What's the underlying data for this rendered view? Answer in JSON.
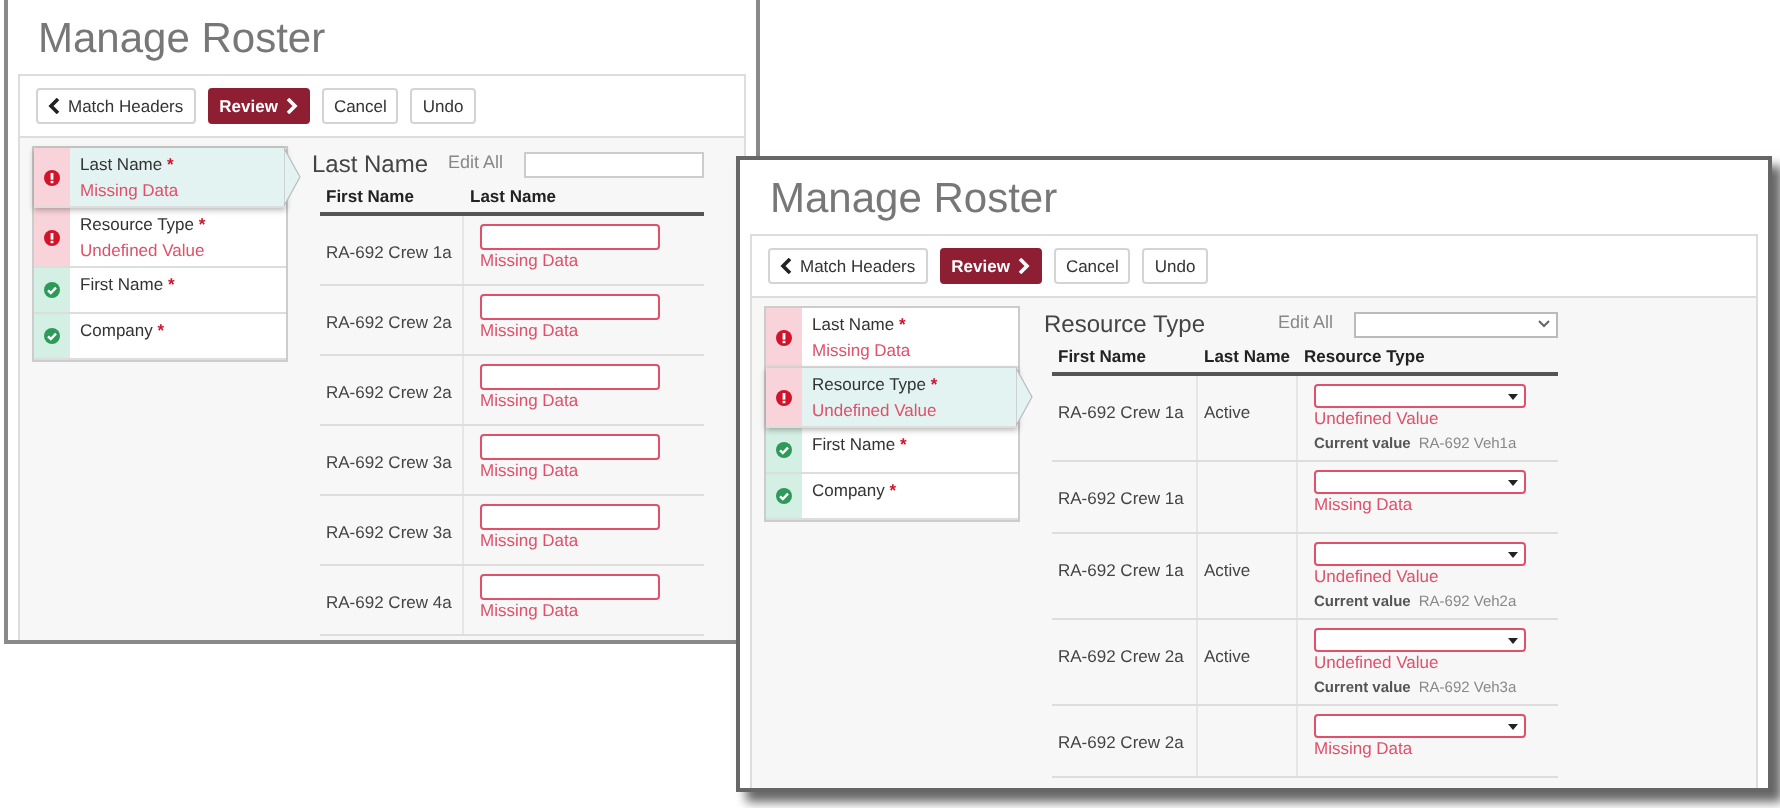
{
  "windows": [
    {
      "title": "Manage Roster",
      "toolbar": [
        {
          "kind": "back",
          "label": "Match Headers"
        },
        {
          "kind": "primary",
          "label": "Review"
        },
        {
          "kind": "plain",
          "label": "Cancel"
        },
        {
          "kind": "plain",
          "label": "Undo"
        }
      ],
      "fields": [
        {
          "label": "Last Name",
          "asterisk": "*",
          "kind": "error",
          "message": "Missing Data",
          "selected": true
        },
        {
          "label": "Resource Type",
          "asterisk": "*",
          "kind": "error",
          "message": "Undefined Value",
          "selected": false
        },
        {
          "label": "First Name",
          "asterisk": "*",
          "kind": "ok",
          "selected": false
        },
        {
          "label": "Company",
          "asterisk": "*",
          "kind": "ok",
          "selected": false
        }
      ],
      "panel": {
        "heading": "Last Name",
        "edit_all": {
          "label": "Edit All",
          "kind": "text"
        },
        "columns": [
          "First Name",
          "Last Name"
        ],
        "rows": [
          {
            "cells": [
              "RA-692 Crew 1a"
            ],
            "kind": "text",
            "message": "Missing Data"
          },
          {
            "cells": [
              "RA-692 Crew 2a"
            ],
            "kind": "text",
            "message": "Missing Data"
          },
          {
            "cells": [
              "RA-692 Crew 2a"
            ],
            "kind": "text",
            "message": "Missing Data"
          },
          {
            "cells": [
              "RA-692 Crew 3a"
            ],
            "kind": "text",
            "message": "Missing Data"
          },
          {
            "cells": [
              "RA-692 Crew 3a"
            ],
            "kind": "text",
            "message": "Missing Data"
          },
          {
            "cells": [
              "RA-692 Crew 4a"
            ],
            "kind": "text",
            "message": "Missing Data"
          }
        ]
      }
    },
    {
      "title": "Manage Roster",
      "toolbar": [
        {
          "kind": "back",
          "label": "Match Headers"
        },
        {
          "kind": "primary",
          "label": "Review"
        },
        {
          "kind": "plain",
          "label": "Cancel"
        },
        {
          "kind": "plain",
          "label": "Undo"
        }
      ],
      "fields": [
        {
          "label": "Last Name",
          "asterisk": "*",
          "kind": "error",
          "message": "Missing Data",
          "selected": false
        },
        {
          "label": "Resource Type",
          "asterisk": "*",
          "kind": "error",
          "message": "Undefined Value",
          "selected": true
        },
        {
          "label": "First Name",
          "asterisk": "*",
          "kind": "ok",
          "selected": false
        },
        {
          "label": "Company",
          "asterisk": "*",
          "kind": "ok",
          "selected": false
        }
      ],
      "panel": {
        "heading": "Resource Type",
        "edit_all": {
          "label": "Edit All",
          "kind": "select"
        },
        "columns": [
          "First Name",
          "Last Name",
          "Resource Type"
        ],
        "rows": [
          {
            "cells": [
              "RA-692 Crew 1a",
              "Active"
            ],
            "kind": "select",
            "message": "Undefined Value",
            "current_label": "Current value",
            "current_value": "RA-692 Veh1a"
          },
          {
            "cells": [
              "RA-692 Crew 1a",
              ""
            ],
            "kind": "select",
            "message": "Missing Data"
          },
          {
            "cells": [
              "RA-692 Crew 1a",
              "Active"
            ],
            "kind": "select",
            "message": "Undefined Value",
            "current_label": "Current value",
            "current_value": "RA-692 Veh2a"
          },
          {
            "cells": [
              "RA-692 Crew 2a",
              "Active"
            ],
            "kind": "select",
            "message": "Undefined Value",
            "current_label": "Current value",
            "current_value": "RA-692 Veh3a"
          },
          {
            "cells": [
              "RA-692 Crew 2a",
              ""
            ],
            "kind": "select",
            "message": "Missing Data"
          }
        ]
      }
    }
  ]
}
